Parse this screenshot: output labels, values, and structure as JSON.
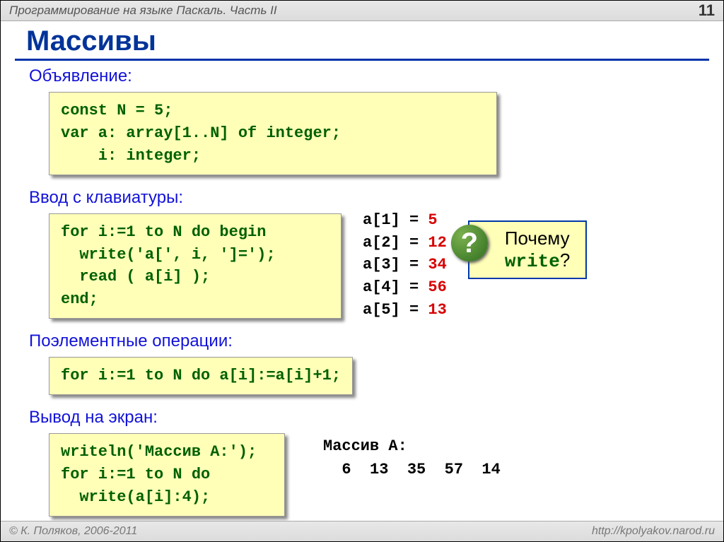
{
  "header": {
    "doc_title": "Программирование на языке Паскаль. Часть II",
    "page_number": "11"
  },
  "title": "Массивы",
  "sections": {
    "decl": "Объявление:",
    "input": "Ввод с клавиатуры:",
    "elem": "Поэлементные операции:",
    "out": "Вывод на экран:"
  },
  "code": {
    "decl_l1": "const N = 5;",
    "decl_l2": "var a: array[1..N] of integer;",
    "decl_l3": "    i: integer;",
    "in_l1": "for i:=1 to N do begin",
    "in_l2": "  write('a[', i, ']=');",
    "in_l3": "  read ( a[i] );",
    "in_l4": "end;",
    "elem_l1": "for i:=1 to N do a[i]:=a[i]+1;",
    "out_l1": "writeln('Массив A:');",
    "out_l2": "for i:=1 to N do",
    "out_l3": "  write(a[i]:4);"
  },
  "array_values": [
    {
      "label": "a[1] =",
      "value": "5"
    },
    {
      "label": "a[2] =",
      "value": "12"
    },
    {
      "label": "a[3] =",
      "value": "34"
    },
    {
      "label": "a[4] =",
      "value": "56"
    },
    {
      "label": "a[5] =",
      "value": "13"
    }
  ],
  "callout": {
    "q": "?",
    "line1": "Почему",
    "line2_mono": "write",
    "line2_tail": "?"
  },
  "output": {
    "line1": "Массив A:",
    "line2": "  6  13  35  57  14"
  },
  "footer": {
    "left": "© К. Поляков, 2006-2011",
    "right": "http://kpolyakov.narod.ru"
  }
}
